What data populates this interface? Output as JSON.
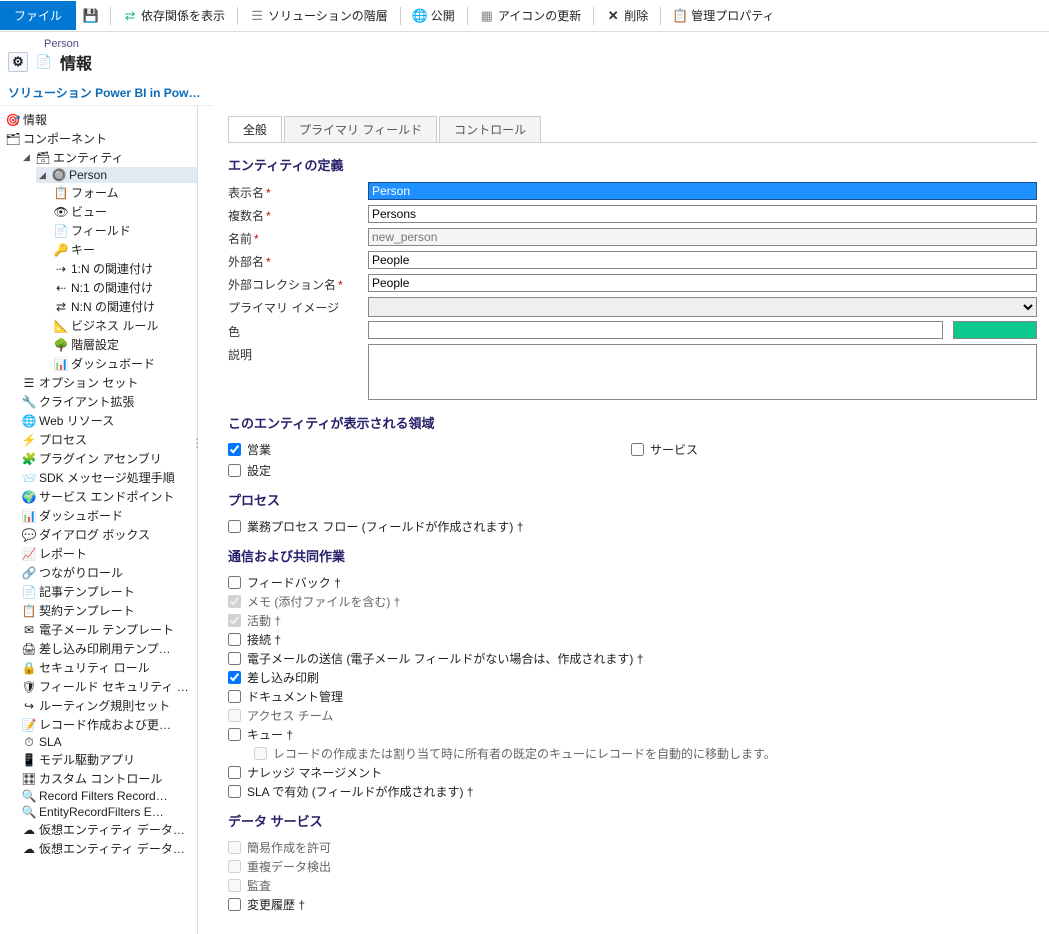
{
  "toolbar": {
    "file": "ファイル",
    "save_title": "保存",
    "show_deps": "依存関係を表示",
    "hierarchy": "ソリューションの階層",
    "publish": "公開",
    "refresh_icons": "アイコンの更新",
    "delete": "削除",
    "manage_props": "管理プロパティ"
  },
  "header": {
    "entity_label": "Person",
    "title": "情報",
    "solution_line": "ソリューション Power BI in Pow…"
  },
  "tree": {
    "info": "情報",
    "components": "コンポーネント",
    "entities": "エンティティ",
    "person": "Person",
    "person_children": [
      "フォーム",
      "ビュー",
      "フィールド",
      "キー",
      "1:N の関連付け",
      "N:1 の関連付け",
      "N:N の関連付け",
      "ビジネス ルール",
      "階層設定",
      "ダッシュボード"
    ],
    "others": [
      "オプション セット",
      "クライアント拡張",
      "Web リソース",
      "プロセス",
      "プラグイン アセンブリ",
      "SDK メッセージ処理手順",
      "サービス エンドポイント",
      "ダッシュボード",
      "ダイアログ ボックス",
      "レポート",
      "つながりロール",
      "記事テンプレート",
      "契約テンプレート",
      "電子メール テンプレート",
      "差し込み印刷用テンプ…",
      "セキュリティ ロール",
      "フィールド セキュリティ …",
      "ルーティング規則セット",
      "レコード作成および更…",
      "SLA",
      "モデル駆動アプリ",
      "カスタム コントロール",
      "Record Filters Record…",
      "EntityRecordFilters E…",
      "仮想エンティティ データ…",
      "仮想エンティティ データ…"
    ]
  },
  "tabs": {
    "general": "全般",
    "primary": "プライマリ フィールド",
    "controls": "コントロール"
  },
  "defsec": "エンティティの定義",
  "labels": {
    "display_name": "表示名",
    "plural_name": "複数名",
    "name": "名前",
    "ext_name": "外部名",
    "ext_coll": "外部コレクション名",
    "primary_image": "プライマリ イメージ",
    "color": "色",
    "description": "説明"
  },
  "values": {
    "display_name": "Person",
    "plural_name": "Persons",
    "name": "new_person",
    "ext_name": "People",
    "ext_coll": "People",
    "color": ""
  },
  "areasec": "このエンティティが表示される領域",
  "areas": {
    "sales": "営業",
    "settings": "設定",
    "service": "サービス"
  },
  "procsec": "プロセス",
  "proc": {
    "bpf": "業務プロセス フロー (フィールドが作成されます) †"
  },
  "collabsec": "通信および共同作業",
  "collab": {
    "feedback": "フィードバック †",
    "notes": "メモ (添付ファイルを含む) †",
    "activities": "活動 †",
    "connections": "接続 †",
    "email": "電子メールの送信 (電子メール フィールドがない場合は、作成されます) †",
    "mailmerge": "差し込み印刷",
    "docmgmt": "ドキュメント管理",
    "accessteam": "アクセス チーム",
    "queues": "キュー †",
    "queues_sub": "レコードの作成または割り当て時に所有者の既定のキューにレコードを自動的に移動します。",
    "knowledge": "ナレッジ マネージメント",
    "sla": "SLA で有効 (フィールドが作成されます) †"
  },
  "datasec": "データ サービス",
  "datasvc": {
    "quick": "簡易作成を許可",
    "dup": "重複データ検出",
    "audit": "監査",
    "change": "変更履歴 †"
  }
}
